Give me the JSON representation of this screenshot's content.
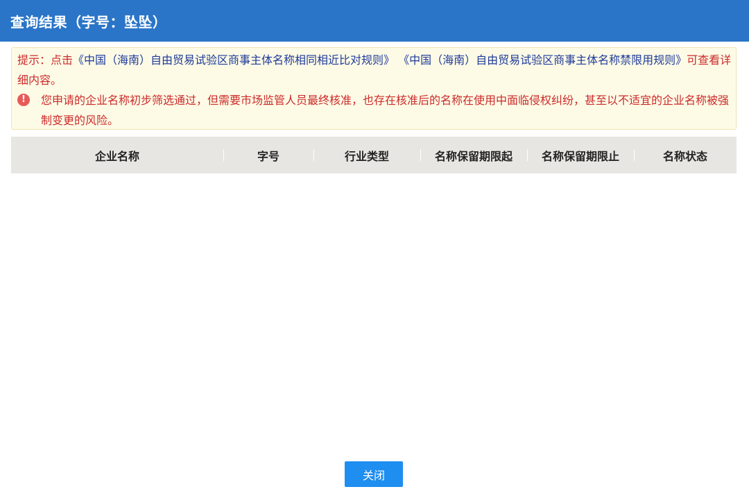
{
  "dialog": {
    "title": "查询结果（字号：坠坠）"
  },
  "notice": {
    "tip_prefix": "提示：点击",
    "link1": "《中国（海南）自由贸易试验区商事主体名称相同相近比对规则》",
    "link2": "《中国（海南）自由贸易试验区商事主体名称禁限用规则》",
    "tip_suffix": "可查看详细内容。",
    "warning_icon": "exclamation-circle-icon",
    "warning_text": "您申请的企业名称初步筛选通过，但需要市场监管人员最终核准，也存在核准后的名称在使用中面临侵权纠纷，甚至以不适宜的企业名称被强制变更的风险。"
  },
  "table": {
    "columns": [
      "企业名称",
      "字号",
      "行业类型",
      "名称保留期限起",
      "名称保留期限止",
      "名称状态"
    ],
    "rows": []
  },
  "footer": {
    "close_label": "关闭"
  },
  "colors": {
    "title_bar": "#2a75c7",
    "notice_bg": "#fdfbe6",
    "warning_text": "#cc2a2a",
    "link_text": "#1e3a9a",
    "button_bg": "#1e8ef0"
  }
}
